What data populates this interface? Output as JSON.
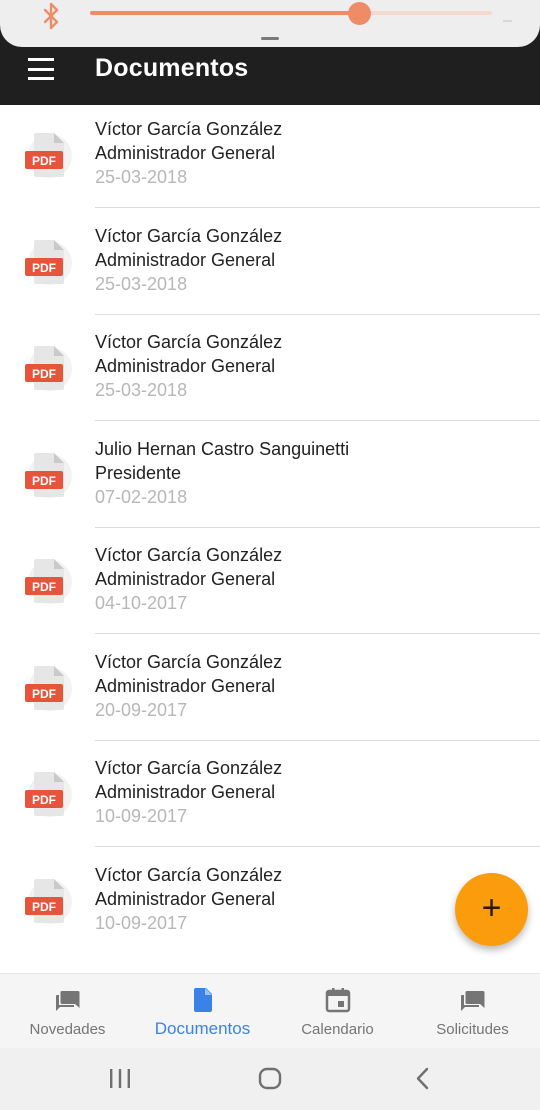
{
  "quick_panel": {
    "brightness_level": 0.67,
    "accent_color": "#ef8c68",
    "bluetooth_icon": "bluetooth-icon"
  },
  "appbar": {
    "title": "Documentos",
    "menu_icon": "hamburger-menu-icon",
    "background": "#1f1f1f"
  },
  "documents": [
    {
      "name": "Víctor García González",
      "role": "Administrador General",
      "date": "25-03-2018",
      "icon": "pdf-file-icon",
      "badge": "PDF"
    },
    {
      "name": "Víctor García González",
      "role": "Administrador General",
      "date": "25-03-2018",
      "icon": "pdf-file-icon",
      "badge": "PDF"
    },
    {
      "name": "Víctor García González",
      "role": "Administrador General",
      "date": "25-03-2018",
      "icon": "pdf-file-icon",
      "badge": "PDF"
    },
    {
      "name": "Julio Hernan Castro Sanguinetti",
      "role": "Presidente",
      "date": "07-02-2018",
      "icon": "pdf-file-icon",
      "badge": "PDF"
    },
    {
      "name": "Víctor García González",
      "role": "Administrador General",
      "date": "04-10-2017",
      "icon": "pdf-file-icon",
      "badge": "PDF"
    },
    {
      "name": "Víctor García González",
      "role": "Administrador General",
      "date": "20-09-2017",
      "icon": "pdf-file-icon",
      "badge": "PDF"
    },
    {
      "name": "Víctor García González",
      "role": "Administrador General",
      "date": "10-09-2017",
      "icon": "pdf-file-icon",
      "badge": "PDF"
    },
    {
      "name": "Víctor García González",
      "role": "Administrador General",
      "date": "10-09-2017",
      "icon": "pdf-file-icon",
      "badge": "PDF"
    }
  ],
  "fab": {
    "label": "+",
    "color": "#fb9c0c",
    "icon": "add-icon"
  },
  "bottom_nav": {
    "items": [
      {
        "label": "Novedades",
        "icon": "chat-bubbles-icon",
        "active": false
      },
      {
        "label": "Documentos",
        "icon": "document-icon",
        "active": true
      },
      {
        "label": "Calendario",
        "icon": "calendar-icon",
        "active": false
      },
      {
        "label": "Solicitudes",
        "icon": "chat-bubbles-icon",
        "active": false
      }
    ],
    "active_color": "#3b82e6",
    "inactive_color": "#757575"
  },
  "system_nav": {
    "recents_icon": "recents-icon",
    "home_icon": "home-icon",
    "back_icon": "back-icon"
  }
}
